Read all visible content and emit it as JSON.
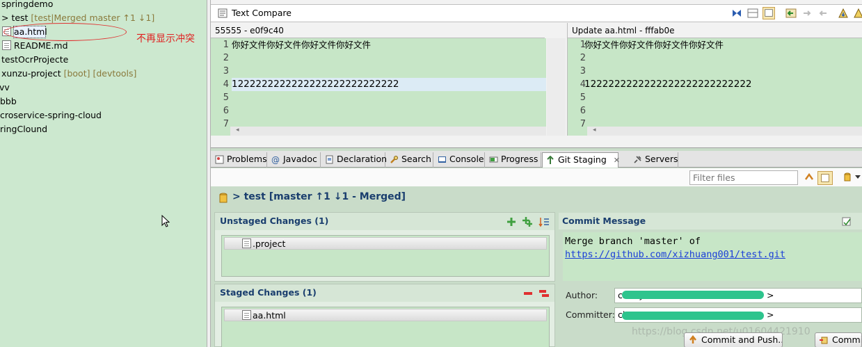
{
  "tree": {
    "items": [
      {
        "label": "springdemo",
        "suffix": ""
      },
      {
        "label": "> test",
        "suffix": " [test|Merged master ↑1 ↓1]"
      },
      {
        "label": "aa.html",
        "suffix": ""
      },
      {
        "label": "README.md",
        "suffix": ""
      },
      {
        "label": "testOcrProjecte",
        "suffix": ""
      },
      {
        "label": "xunzu-project",
        "suffix": " [boot] [devtools]"
      },
      {
        "label": "vv",
        "suffix": ""
      },
      {
        "label": "bbb",
        "suffix": ""
      },
      {
        "label": "croservice-spring-cloud",
        "suffix": ""
      },
      {
        "label": "ringClound",
        "suffix": ""
      }
    ],
    "annotation": "不再显示冲突"
  },
  "compare": {
    "title": "Text Compare",
    "left_header": "55555 - e0f9c40",
    "right_header": "Update aa.html - fffab0e",
    "line_numbers": [
      "1",
      "2",
      "3",
      "4",
      "5",
      "6",
      "7"
    ],
    "left_lines": [
      "你好文件你好文件你好文件你好文件",
      "",
      "",
      "1222222222222222222222222222",
      "",
      "",
      ""
    ],
    "right_lines": [
      "你好文件你好文件你好文件你好文件",
      "",
      "",
      "1222222222222222222222222222",
      "",
      "",
      ""
    ],
    "scroll_arrow": "◂"
  },
  "tabs": [
    {
      "label": "Problems"
    },
    {
      "label": "Javadoc"
    },
    {
      "label": "Declaration"
    },
    {
      "label": "Search"
    },
    {
      "label": "Console"
    },
    {
      "label": "Progress"
    },
    {
      "label": "Git Staging",
      "close": "✕"
    },
    {
      "label": "Servers"
    }
  ],
  "staging": {
    "filter_placeholder": "Filter files",
    "repo_title": "> test [master ↑1 ↓1 - Merged]",
    "unstaged_title": "Unstaged Changes (1)",
    "unstaged_files": [
      ".project"
    ],
    "staged_title": "Staged Changes (1)",
    "staged_files": [
      "aa.html"
    ],
    "commit_title": "Commit Message",
    "commit_line1": "Merge branch 'master' of",
    "commit_link": "https://github.com/xizhuang001/test.git",
    "author_label": "Author:",
    "author_value": "chenyo",
    "author_suffix": ">",
    "committer_label": "Committer:",
    "committer_value": "chenyo",
    "committer_suffix": ">",
    "commit_push_label": "Commit and Push...",
    "commit_label": "Commit",
    "watermark": "https://blog.csdn.net/u01604421910"
  },
  "colors": {
    "editor_green": "#c7e6c7",
    "accent_blue": "#1a3e6e",
    "annotation_red": "#e02020",
    "redaction_green": "#2ec48d"
  }
}
